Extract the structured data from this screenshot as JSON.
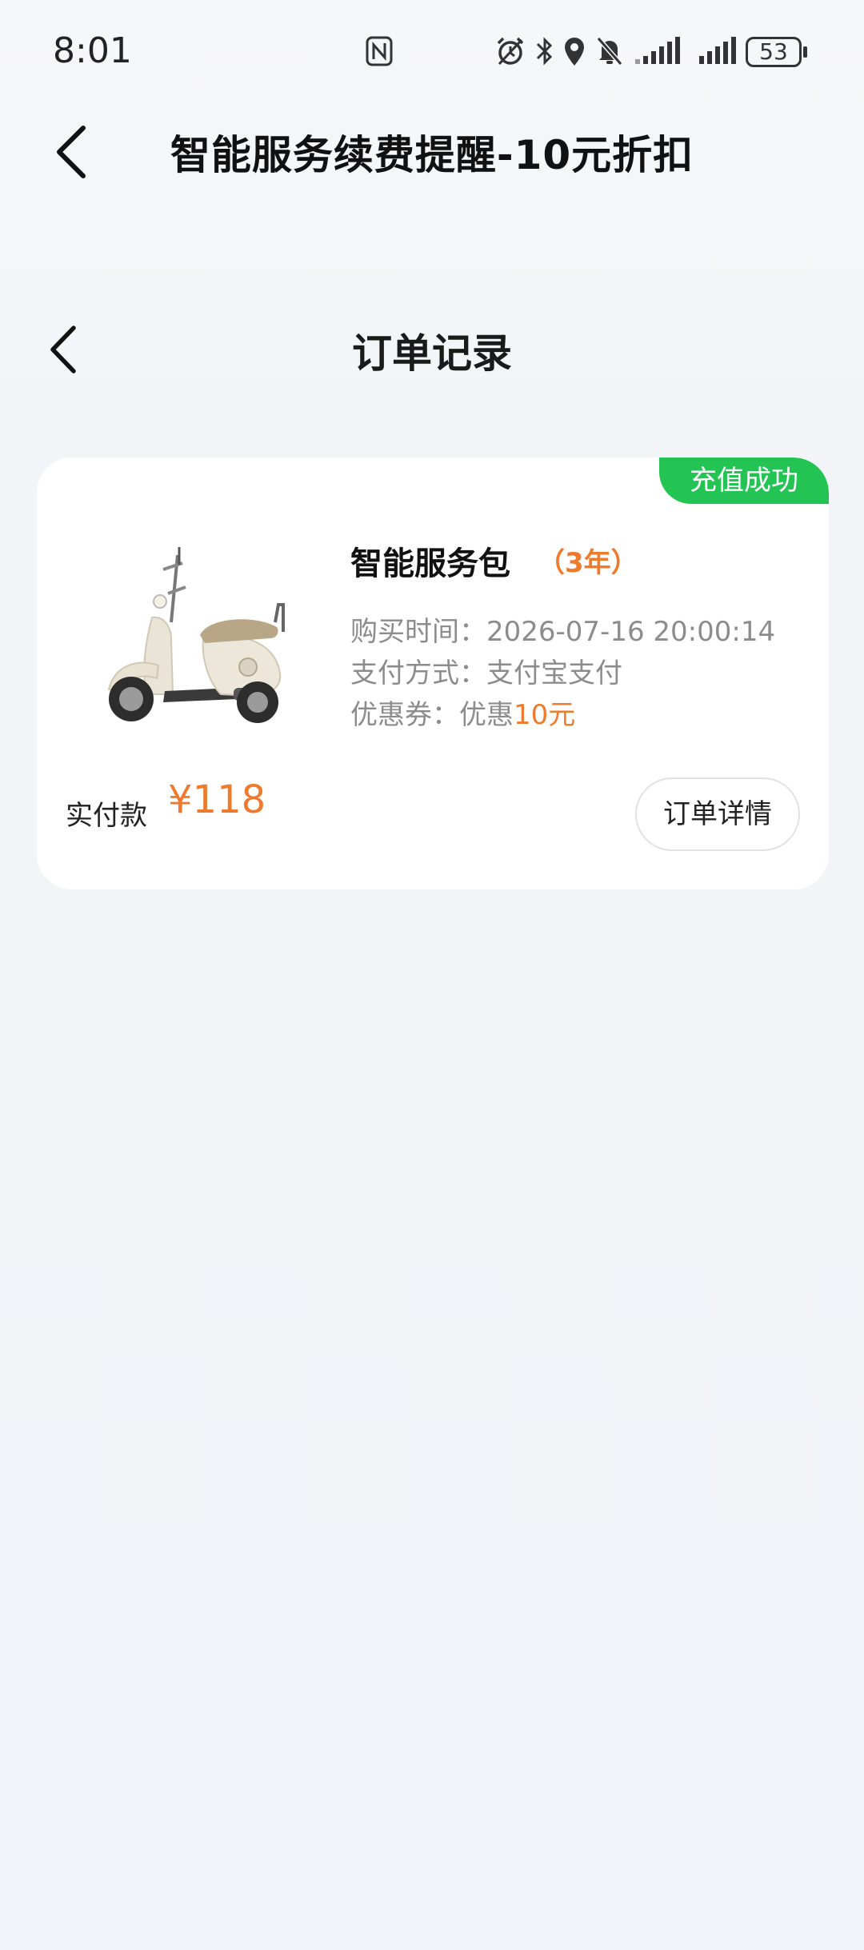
{
  "status_bar": {
    "time": "8:01",
    "battery": "53",
    "icons": [
      "nfc-icon",
      "alarm-icon",
      "bluetooth-icon",
      "location-icon",
      "mute-icon",
      "signal-icon",
      "signal-icon",
      "battery-icon"
    ]
  },
  "outer_header": {
    "title": "智能服务续费提醒-10元折扣",
    "back_icon": "chevron-left-icon"
  },
  "inner_header": {
    "title": "订单记录",
    "back_icon": "chevron-left-icon"
  },
  "order": {
    "status": "充值成功",
    "product_name": "智能服务包",
    "product_term": "（3年）",
    "purchase_time_label": "购买时间：",
    "purchase_time": "2026-07-16 20:00:14",
    "payment_method_label": "支付方式：",
    "payment_method": "支付宝支付",
    "coupon_label": "优惠券：",
    "coupon_prefix": "优惠",
    "coupon_amount": "10元",
    "paid_label": "实付款",
    "paid_amount": "¥118",
    "detail_button": "订单详情"
  },
  "colors": {
    "accent": "#ee7a2d",
    "success": "#23c454",
    "background": "#f1f4f8"
  }
}
